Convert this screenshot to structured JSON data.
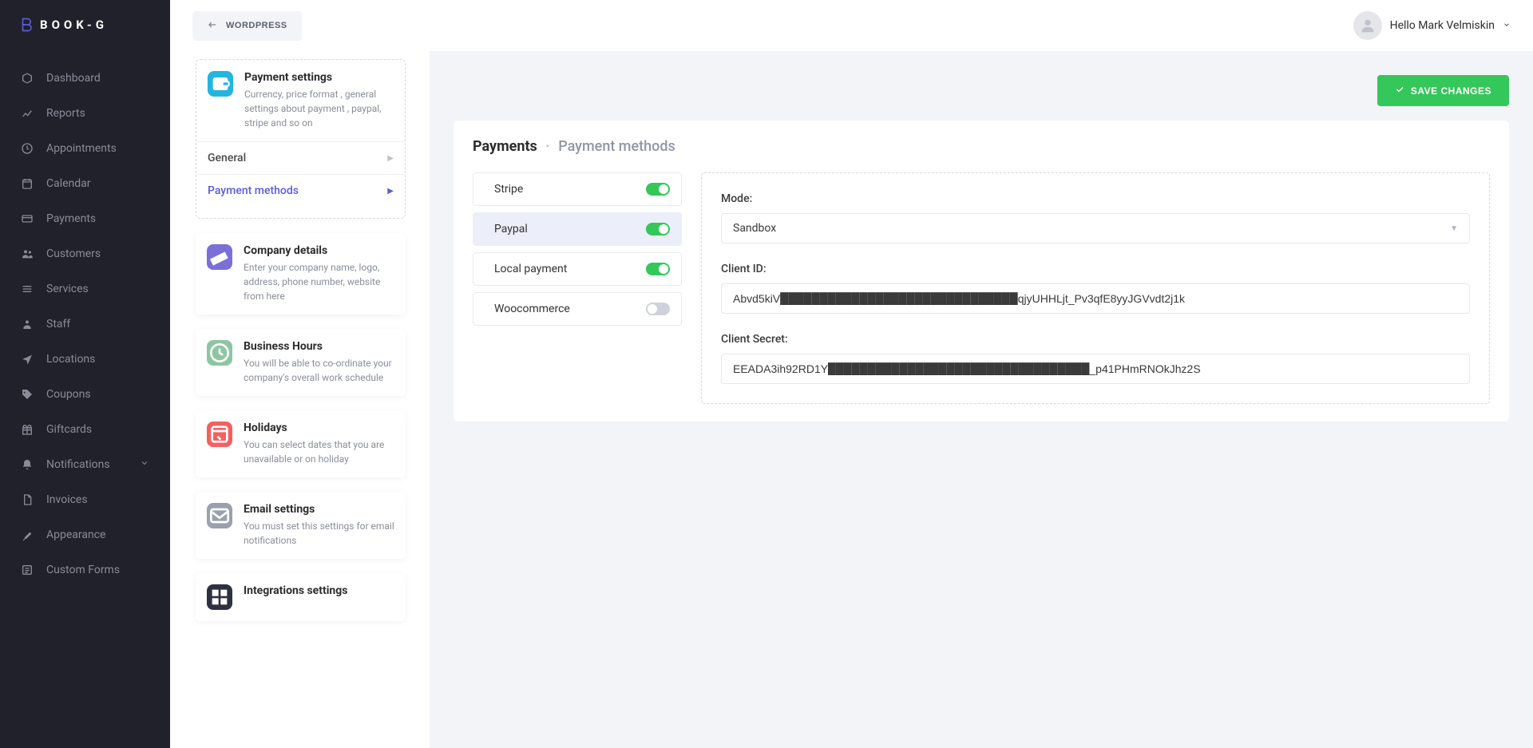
{
  "brand": {
    "name": "BOOK-G"
  },
  "topbar": {
    "wordpress_label": "WORDPRESS",
    "user_greeting": "Hello Mark Velmiskin"
  },
  "sidebar": {
    "items": [
      {
        "label": "Dashboard",
        "icon": "cube-icon"
      },
      {
        "label": "Reports",
        "icon": "chart-icon"
      },
      {
        "label": "Appointments",
        "icon": "clock-icon"
      },
      {
        "label": "Calendar",
        "icon": "calendar-icon"
      },
      {
        "label": "Payments",
        "icon": "card-icon"
      },
      {
        "label": "Customers",
        "icon": "users-icon"
      },
      {
        "label": "Services",
        "icon": "list-icon"
      },
      {
        "label": "Staff",
        "icon": "person-icon"
      },
      {
        "label": "Locations",
        "icon": "location-icon"
      },
      {
        "label": "Coupons",
        "icon": "tag-icon"
      },
      {
        "label": "Giftcards",
        "icon": "gift-icon"
      },
      {
        "label": "Notifications",
        "icon": "bell-icon",
        "expandable": true
      },
      {
        "label": "Invoices",
        "icon": "file-icon"
      },
      {
        "label": "Appearance",
        "icon": "brush-icon"
      },
      {
        "label": "Custom Forms",
        "icon": "form-icon"
      }
    ]
  },
  "settings_panel": {
    "cards": [
      {
        "title": "Payment settings",
        "desc": "Currency, price format , general settings about payment , paypal, stripe and so on",
        "icon_class": "ic-blue",
        "active": true,
        "subitems": [
          {
            "label": "General",
            "active": false
          },
          {
            "label": "Payment methods",
            "active": true
          }
        ]
      },
      {
        "title": "Company details",
        "desc": "Enter your company name, logo, address, phone number, website from here",
        "icon_class": "ic-purple"
      },
      {
        "title": "Business Hours",
        "desc": "You will be able to co-ordinate your company's overall work schedule",
        "icon_class": "ic-green"
      },
      {
        "title": "Holidays",
        "desc": "You can select dates that you are unavailable or on holiday",
        "icon_class": "ic-red"
      },
      {
        "title": "Email settings",
        "desc": "You must set this settings for email notifications",
        "icon_class": "ic-gray"
      },
      {
        "title": "Integrations settings",
        "desc": "",
        "icon_class": "ic-dark"
      }
    ]
  },
  "breadcrumb": {
    "root": "Payments",
    "tail": "Payment methods"
  },
  "save_button_label": "SAVE CHANGES",
  "methods": [
    {
      "name": "Stripe",
      "enabled": true,
      "selected": false
    },
    {
      "name": "Paypal",
      "enabled": true,
      "selected": true
    },
    {
      "name": "Local payment",
      "enabled": true,
      "selected": false
    },
    {
      "name": "Woocommerce",
      "enabled": false,
      "selected": false
    }
  ],
  "paypal_config": {
    "mode_label": "Mode:",
    "mode_value": "Sandbox",
    "client_id_label": "Client ID:",
    "client_id_value": "Abvd5kiV██████████████████████████████qjyUHHLjt_Pv3qfE8yyJGVvdt2j1k",
    "client_secret_label": "Client Secret:",
    "client_secret_value": "EEADA3ih92RD1Y█████████████████████████████████_p41PHmRNOkJhz2S"
  }
}
